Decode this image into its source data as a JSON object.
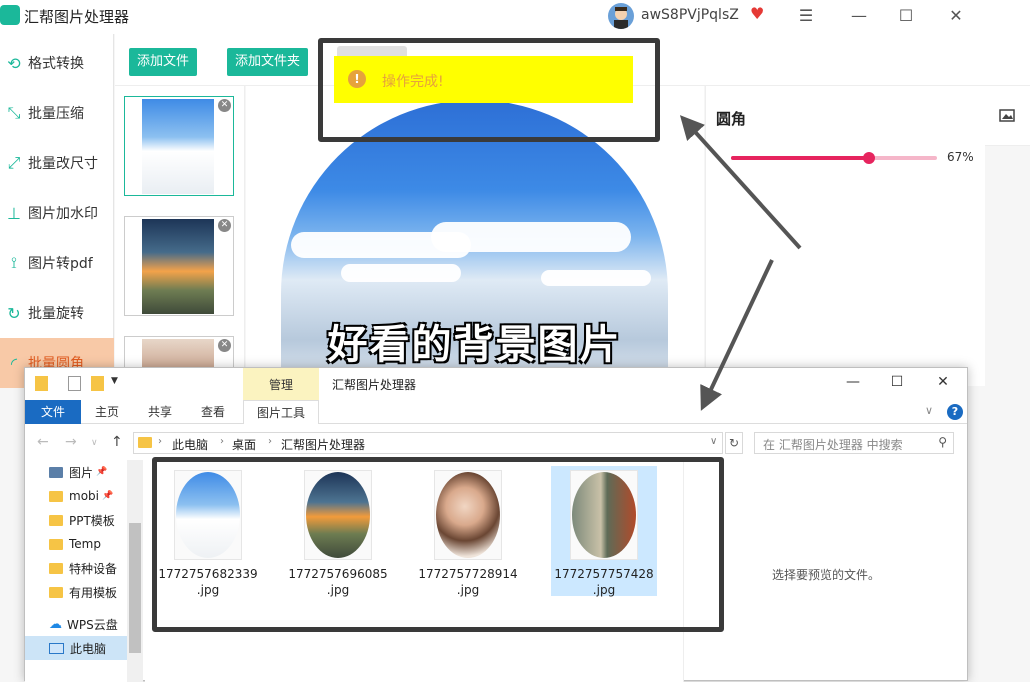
{
  "app": {
    "title": "汇帮图片处理器",
    "username": "awS8PVjPqlsZ"
  },
  "sidebar": {
    "items": [
      {
        "label": "格式转换"
      },
      {
        "label": "批量压缩"
      },
      {
        "label": "批量改尺寸"
      },
      {
        "label": "图片加水印"
      },
      {
        "label": "图片转pdf"
      },
      {
        "label": "批量旋转"
      },
      {
        "label": "批量圆角"
      }
    ]
  },
  "toolbar": {
    "add_file": "添加文件",
    "add_folder": "添加文件夹"
  },
  "preview": {
    "caption": "好看的背景图片"
  },
  "settings": {
    "radius_label": "圆角",
    "radius_value": 67,
    "radius_value_text": "67%"
  },
  "toast": {
    "message": "操作完成!",
    "icon": "!"
  },
  "explorer": {
    "context_tab": "管理",
    "title": "汇帮图片处理器",
    "ribbon_tabs": [
      "文件",
      "主页",
      "共享",
      "查看",
      "图片工具"
    ],
    "breadcrumb": [
      "此电脑",
      "桌面",
      "汇帮图片处理器"
    ],
    "search_placeholder": "在 汇帮图片处理器 中搜索",
    "nav_items": [
      {
        "label": "图片"
      },
      {
        "label": "mobi"
      },
      {
        "label": "PPT模板"
      },
      {
        "label": "Temp"
      },
      {
        "label": "特种设备"
      },
      {
        "label": "有用模板"
      },
      {
        "label": "WPS云盘"
      },
      {
        "label": "此电脑"
      }
    ],
    "files": [
      {
        "name_line1": "1772757682339",
        "name_line2": ".jpg"
      },
      {
        "name_line1": "1772757696085",
        "name_line2": ".jpg"
      },
      {
        "name_line1": "1772757728914",
        "name_line2": ".jpg"
      },
      {
        "name_line1": "1772757757428",
        "name_line2": ".jpg"
      }
    ],
    "preview_hint": "选择要预览的文件。"
  },
  "colors": {
    "accent": "#1bb89a",
    "slider": "#e6245e",
    "toast_bg": "#ffff00",
    "active_side": "#f8c9a7",
    "explorer_blue": "#1a6bc2"
  }
}
